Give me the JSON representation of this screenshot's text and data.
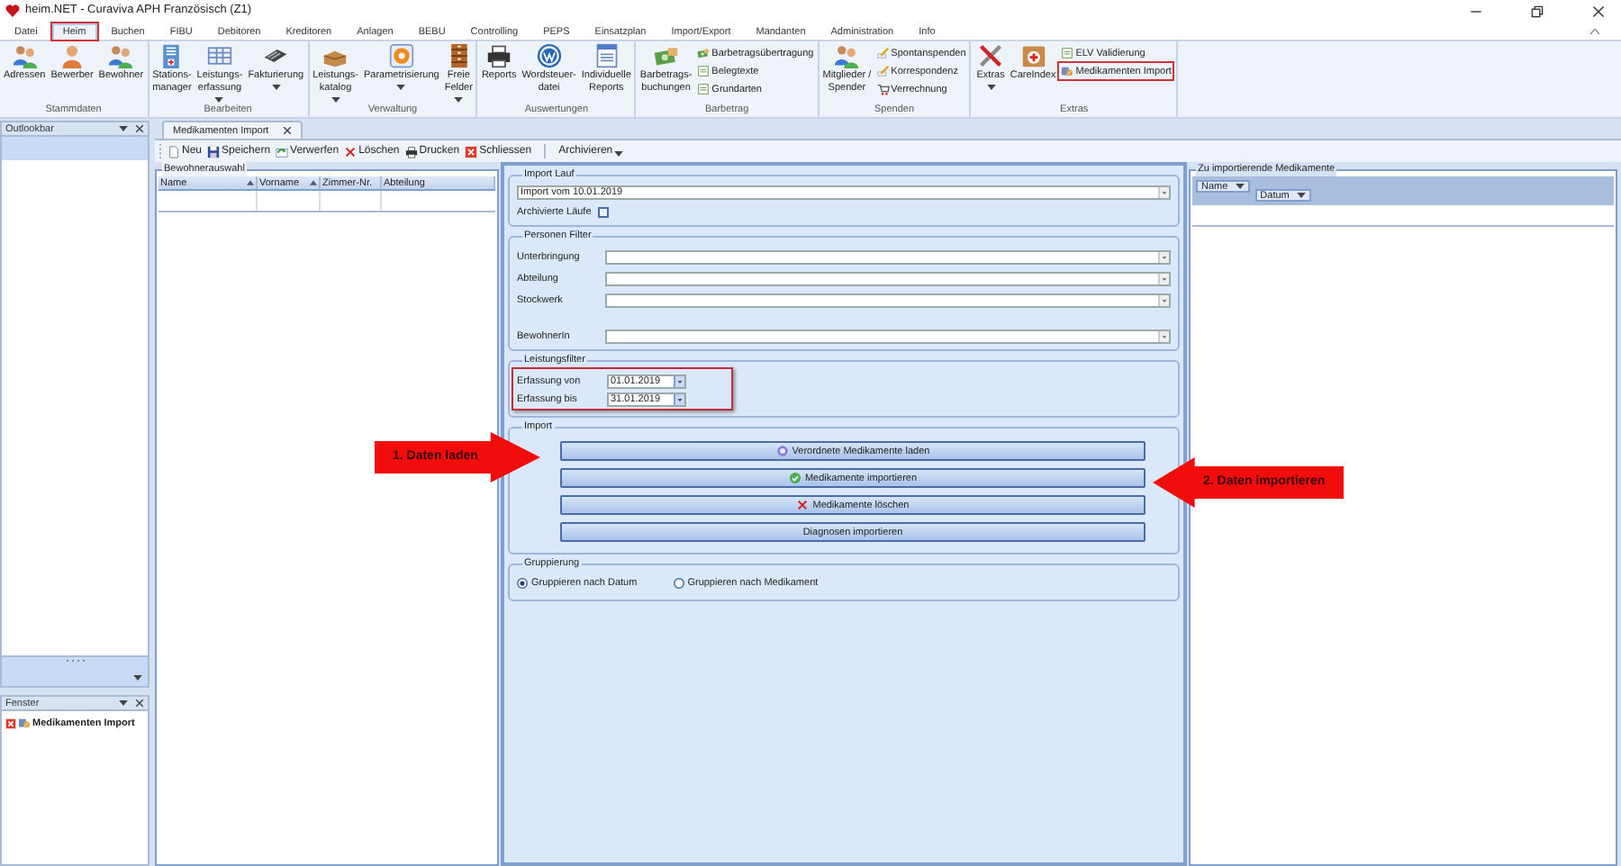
{
  "window": {
    "title": "heim.NET - Curaviva APH Französisch (Z1)"
  },
  "menu_tabs": [
    {
      "label": "Datei",
      "selected": false,
      "highlighted": false
    },
    {
      "label": "Heim",
      "selected": true,
      "highlighted": true
    },
    {
      "label": "Buchen",
      "selected": false,
      "highlighted": false
    },
    {
      "label": "FIBU",
      "selected": false,
      "highlighted": false
    },
    {
      "label": "Debitoren",
      "selected": false,
      "highlighted": false
    },
    {
      "label": "Kreditoren",
      "selected": false,
      "highlighted": false
    },
    {
      "label": "Anlagen",
      "selected": false,
      "highlighted": false
    },
    {
      "label": "BEBU",
      "selected": false,
      "highlighted": false
    },
    {
      "label": "Controlling",
      "selected": false,
      "highlighted": false
    },
    {
      "label": "PEPS",
      "selected": false,
      "highlighted": false
    },
    {
      "label": "Einsatzplan",
      "selected": false,
      "highlighted": false
    },
    {
      "label": "Import/Export",
      "selected": false,
      "highlighted": false
    },
    {
      "label": "Mandanten",
      "selected": false,
      "highlighted": false
    },
    {
      "label": "Administration",
      "selected": false,
      "highlighted": false
    },
    {
      "label": "Info",
      "selected": false,
      "highlighted": false
    }
  ],
  "ribbon_groups": [
    {
      "title": "Stammdaten",
      "items": [
        {
          "label": "Adressen",
          "kind": "large",
          "dropdown": false,
          "highlighted": false
        },
        {
          "label": "Bewerber",
          "kind": "large",
          "dropdown": false,
          "highlighted": false
        },
        {
          "label": "Bewohner",
          "kind": "large",
          "dropdown": false,
          "highlighted": false
        }
      ]
    },
    {
      "title": "Bearbeiten",
      "items": [
        {
          "label": "Stations-\nmanager",
          "kind": "large",
          "dropdown": false,
          "highlighted": false
        },
        {
          "label": "Leistungs-\nerfassung",
          "kind": "large",
          "dropdown": true,
          "highlighted": false
        },
        {
          "label": "Fakturierung",
          "kind": "large",
          "dropdown": true,
          "highlighted": false
        }
      ]
    },
    {
      "title": "Verwaltung",
      "items": [
        {
          "label": "Leistungs-\nkatalog",
          "kind": "large",
          "dropdown": true,
          "highlighted": false
        },
        {
          "label": "Parametrisierung",
          "kind": "large",
          "dropdown": true,
          "highlighted": false
        },
        {
          "label": "Freie\nFelder",
          "kind": "large",
          "dropdown": true,
          "highlighted": false
        }
      ]
    },
    {
      "title": "Auswertungen",
      "items": [
        {
          "label": "Reports",
          "kind": "large",
          "dropdown": false,
          "highlighted": false
        },
        {
          "label": "Wordsteuer-\ndatei",
          "kind": "large",
          "dropdown": false,
          "highlighted": false
        },
        {
          "label": "Individuelle\nReports",
          "kind": "large",
          "dropdown": false,
          "highlighted": false
        }
      ]
    },
    {
      "title": "Barbetrag",
      "items": [
        {
          "label": "Barbetrags-\nbuchungen",
          "kind": "large",
          "dropdown": false,
          "highlighted": false
        },
        {
          "label": "Barbetragsübertragung",
          "kind": "small",
          "dropdown": false,
          "highlighted": false
        },
        {
          "label": "Belegtexte",
          "kind": "small",
          "dropdown": false,
          "highlighted": false
        },
        {
          "label": "Grundarten",
          "kind": "small",
          "dropdown": false,
          "highlighted": false
        }
      ]
    },
    {
      "title": "Spenden",
      "items": [
        {
          "label": "Mitglieder /\nSpender",
          "kind": "large",
          "dropdown": false,
          "highlighted": false
        },
        {
          "label": "Spontanspenden",
          "kind": "small",
          "dropdown": false,
          "highlighted": false
        },
        {
          "label": "Korrespondenz",
          "kind": "small",
          "dropdown": false,
          "highlighted": false
        },
        {
          "label": "Verrechnung",
          "kind": "small",
          "dropdown": false,
          "highlighted": false
        }
      ]
    },
    {
      "title": "Extras",
      "items": [
        {
          "label": "Extras",
          "kind": "large",
          "dropdown": true,
          "highlighted": false
        },
        {
          "label": "CareIndex",
          "kind": "large",
          "dropdown": false,
          "highlighted": false
        },
        {
          "label": "ELV Validierung",
          "kind": "small",
          "dropdown": false,
          "highlighted": false
        },
        {
          "label": "Medikamenten Import",
          "kind": "small",
          "dropdown": false,
          "highlighted": true
        }
      ]
    }
  ],
  "outlookbar": {
    "title": "Outlookbar"
  },
  "fenster": {
    "title": "Fenster",
    "items": [
      {
        "label": "Medikamenten Import"
      }
    ]
  },
  "document_tab": {
    "label": "Medikamenten Import"
  },
  "toolbar": [
    {
      "label": "Neu",
      "dropdown": false
    },
    {
      "label": "Speichern",
      "dropdown": false
    },
    {
      "label": "Verwerfen",
      "dropdown": false
    },
    {
      "label": "Löschen",
      "dropdown": false
    },
    {
      "label": "Drucken",
      "dropdown": false
    },
    {
      "label": "Schliessen",
      "dropdown": false
    },
    {
      "label": "Archivieren",
      "dropdown": true
    }
  ],
  "bewohnerauswahl": {
    "title": "Bewohnerauswahl",
    "columns": [
      {
        "label": "Name",
        "sorted": true
      },
      {
        "label": "Vorname",
        "sorted": true
      },
      {
        "label": "Zimmer-Nr.",
        "sorted": false
      },
      {
        "label": "Abteilung",
        "sorted": false
      }
    ]
  },
  "import_lauf": {
    "title": "Import Lauf",
    "value": "Import vom 10.01.2019",
    "checkbox": {
      "label": "Archivierte Läufe",
      "checked": false
    }
  },
  "personen_filter": {
    "title": "Personen Filter",
    "fields": [
      {
        "label": "Unterbringung"
      },
      {
        "label": "Abteilung"
      },
      {
        "label": "Stockwerk"
      },
      {
        "label": "BewohnerIn"
      }
    ]
  },
  "leistungsfilter": {
    "title": "Leistungsfilter",
    "highlighted": true,
    "fields": [
      {
        "label": "Erfassung von",
        "value": "01.01.2019"
      },
      {
        "label": "Erfassung bis",
        "value": "31.01.2019"
      }
    ]
  },
  "import": {
    "title": "Import",
    "buttons": [
      {
        "label": "Verordnete Medikamente laden",
        "kind": "load"
      },
      {
        "label": "Medikamente importieren",
        "kind": "import"
      },
      {
        "label": "Medikamente löschen",
        "kind": "delete"
      },
      {
        "label": "Diagnosen importieren",
        "kind": "plain"
      }
    ]
  },
  "gruppierung": {
    "title": "Gruppierung",
    "options": [
      {
        "label": "Gruppieren nach Datum",
        "selected": true
      },
      {
        "label": "Gruppieren nach Medikament",
        "selected": false
      }
    ]
  },
  "zu_importierende": {
    "title": "Zu importierende Medikamente",
    "group_chips": [
      {
        "label": "Name"
      },
      {
        "label": "Datum"
      }
    ]
  },
  "annotations": [
    {
      "text": "1. Daten laden"
    },
    {
      "text": "2. Daten importieren"
    }
  ]
}
